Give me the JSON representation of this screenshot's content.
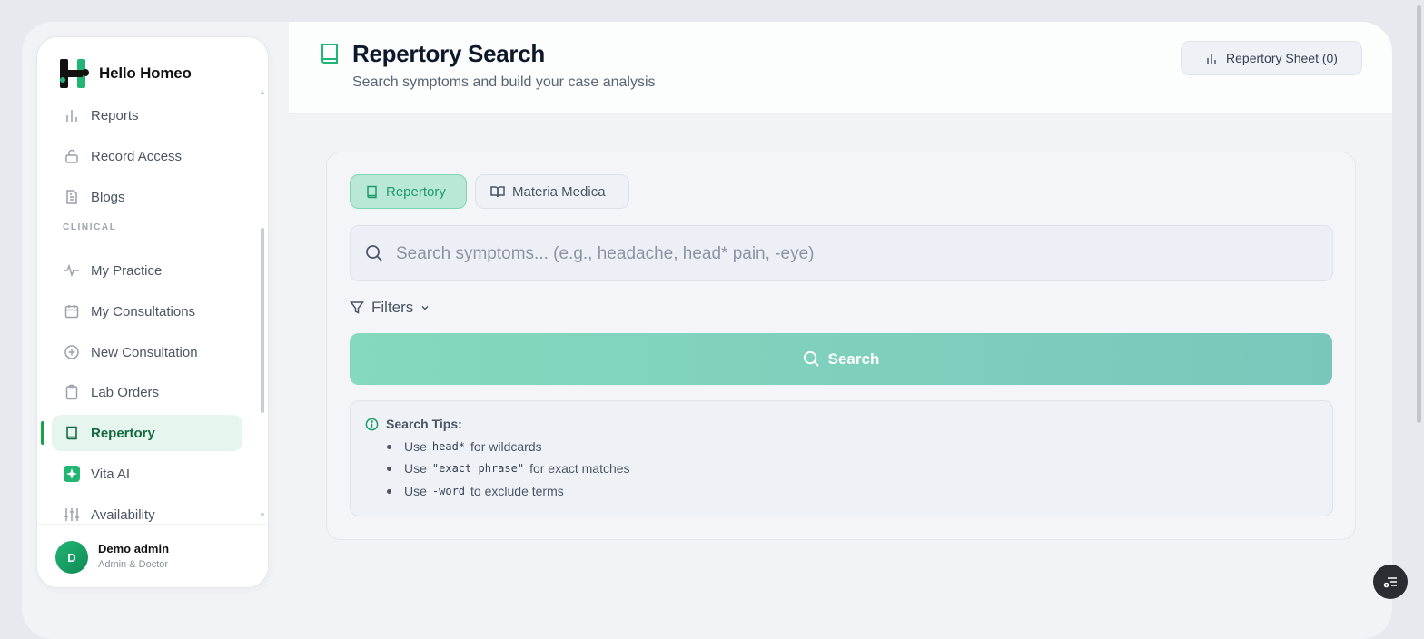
{
  "brand": {
    "name": "Hello Homeo"
  },
  "sidebar": {
    "items_top": [
      {
        "label": "Reports",
        "icon": "bar-chart-icon"
      },
      {
        "label": "Record Access",
        "icon": "lock-open-icon"
      },
      {
        "label": "Blogs",
        "icon": "document-icon"
      }
    ],
    "section_label": "CLINICAL",
    "items_clinical": [
      {
        "label": "My Practice",
        "icon": "activity-icon"
      },
      {
        "label": "My Consultations",
        "icon": "calendar-icon"
      },
      {
        "label": "New Consultation",
        "icon": "plus-circle-icon"
      },
      {
        "label": "Lab Orders",
        "icon": "clipboard-icon"
      },
      {
        "label": "Repertory",
        "icon": "book-icon",
        "active": true
      },
      {
        "label": "Vita AI",
        "icon": "sparkle-icon"
      },
      {
        "label": "Availability",
        "icon": "sliders-icon"
      }
    ],
    "user": {
      "initial": "D",
      "name": "Demo admin",
      "role": "Admin & Doctor"
    }
  },
  "header": {
    "title": "Repertory Search",
    "subtitle": "Search symptoms and build your case analysis",
    "sheet_button": "Repertory Sheet (0)"
  },
  "search": {
    "tabs": [
      {
        "label": "Repertory",
        "active": true
      },
      {
        "label": "Materia Medica",
        "active": false
      }
    ],
    "placeholder": "Search symptoms... (e.g., headache, head* pain, -eye)",
    "filters_label": "Filters",
    "button_label": "Search",
    "tips": {
      "heading": "Search Tips:",
      "items": [
        {
          "pre": "Use",
          "code": "head*",
          "post": "for wildcards"
        },
        {
          "pre": "Use",
          "code": "\"exact phrase\"",
          "post": "for exact matches"
        },
        {
          "pre": "Use",
          "code": "-word",
          "post": "to exclude terms"
        }
      ]
    }
  },
  "colors": {
    "accent": "#16a34a",
    "accent_soft": "#e6f5ee",
    "button": "#84d9be"
  }
}
